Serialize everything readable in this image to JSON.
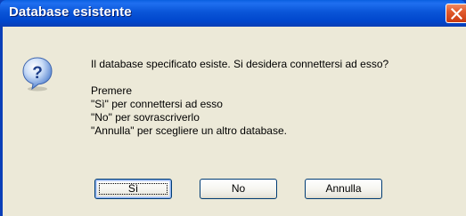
{
  "window": {
    "title": "Database esistente",
    "close_icon": "close-icon"
  },
  "dialog": {
    "icon": "question-icon",
    "message_lines": [
      "Il database specificato esiste. Si desidera connettersi ad esso?",
      "Premere",
      "\"Sì\" per connettersi ad esso",
      "\"No\" per sovrascriverlo",
      "\"Annulla\" per scegliere un altro database."
    ]
  },
  "buttons": {
    "yes_label": "Sì",
    "no_label": "No",
    "cancel_label": "Annulla"
  },
  "colors": {
    "titlebar": "#0046cc",
    "dialog_bg": "#ece9d8",
    "close_button": "#e15a2c"
  }
}
